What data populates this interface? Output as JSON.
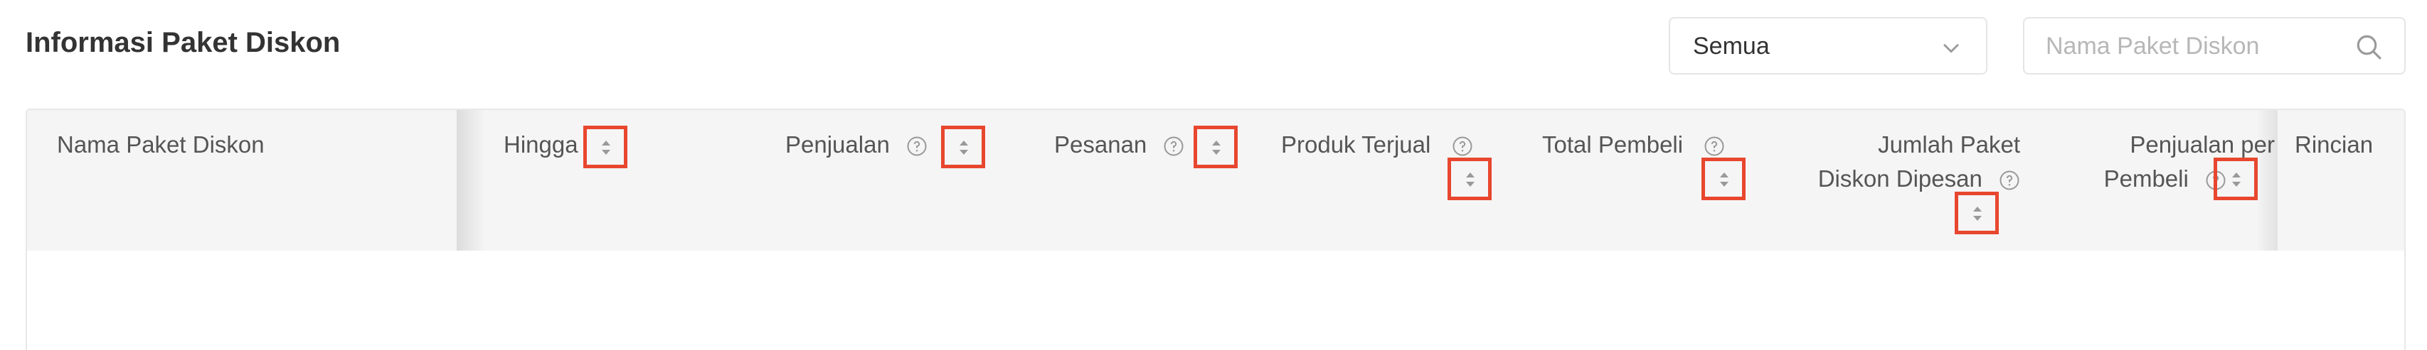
{
  "header": {
    "title": "Informasi Paket Diskon"
  },
  "filter": {
    "status_value": "Semua",
    "search_placeholder": "Nama Paket Diskon"
  },
  "table": {
    "columns": {
      "name": "Nama Paket Diskon",
      "until": "Hingga",
      "sales": "Penjualan",
      "orders": "Pesanan",
      "products_sold": "Produk Terjual",
      "total_buyers": "Total Pembeli",
      "packages_ordered_line1": "Jumlah Paket",
      "packages_ordered_line2": "Diskon Dipesan",
      "sales_per_buyer_line1": "Penjualan per",
      "sales_per_buyer_line2": "Pembeli",
      "details": "Rincian"
    },
    "rows": []
  },
  "colors": {
    "highlight": "#e8472f",
    "header_bg": "#f5f5f5"
  },
  "icons": [
    "chevron-down-icon",
    "search-icon",
    "help-icon",
    "sort-icon"
  ]
}
